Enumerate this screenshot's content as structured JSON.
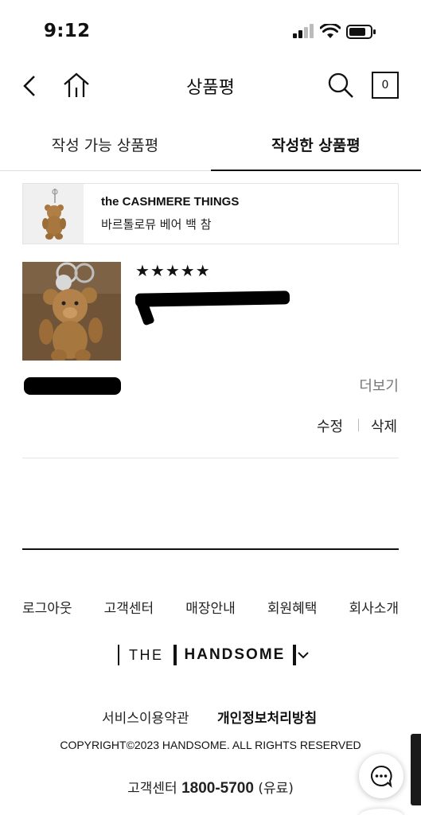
{
  "status_bar": {
    "time": "9:12"
  },
  "header": {
    "title": "상품평",
    "cart_count": "0"
  },
  "tabs": [
    {
      "label": "작성 가능 상품평",
      "active": false
    },
    {
      "label": "작성한 상품평",
      "active": true
    }
  ],
  "product": {
    "brand": "the CASHMERE THINGS",
    "name": "바르톨로뮤 베어 백 참"
  },
  "review": {
    "rating": 5,
    "stars": "★★★★★",
    "more_label": "더보기",
    "edit_label": "수정",
    "delete_label": "삭제"
  },
  "footer": {
    "links": [
      "로그아웃",
      "고객센터",
      "매장안내",
      "회원혜택",
      "회사소개"
    ],
    "brand_the": "THE",
    "brand_name": "HANDSOME",
    "terms_label": "서비스이용약관",
    "privacy_label": "개인정보처리방침",
    "copyright": "COPYRIGHT©2023 HANDSOME. ALL RIGHTS RESERVED",
    "cs_label": "고객센터",
    "cs_number": "1800-5700",
    "cs_note": "(유료)"
  },
  "icons": [
    "back-icon",
    "home-icon",
    "search-icon",
    "cart-icon",
    "chevron-down-icon",
    "chat-icon"
  ]
}
